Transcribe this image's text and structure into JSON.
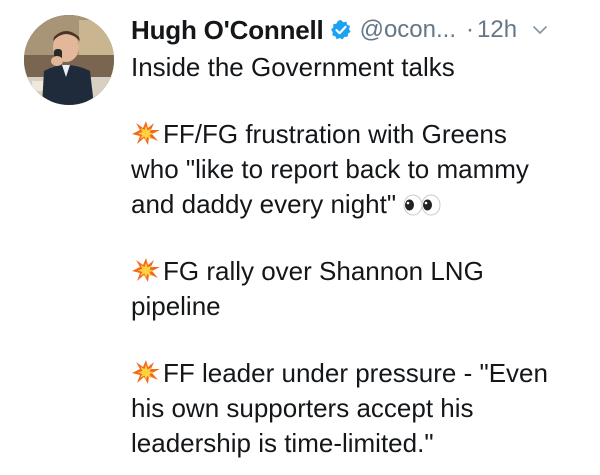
{
  "tweet": {
    "author": {
      "display_name": "Hugh O'Connell",
      "handle": "@ocon...",
      "verified": true,
      "avatar_icon": "profile-photo"
    },
    "separator": "·",
    "timestamp": "12h",
    "menu_icon": "chevron-down-icon",
    "lines": {
      "intro": "Inside the Government talks",
      "item1_line1": "FF/FG frustration with Greens",
      "item1_line2": "who \"like to report back to mammy",
      "item1_line3": "and daddy every night\"",
      "item2_line1": "FG rally over Shannon LNG",
      "item2_line2": "pipeline",
      "item3_line1": "FF leader under pressure - \"Even",
      "item3_line2": "his own supporters accept his",
      "item3_line3": "leadership is time-limited.\""
    },
    "bullet_icon": "collision-emoji-icon",
    "trailing_icon": "eyes-emoji-icon"
  },
  "colors": {
    "text": "#14171a",
    "secondary": "#657786",
    "verified": "#1da1f2"
  }
}
